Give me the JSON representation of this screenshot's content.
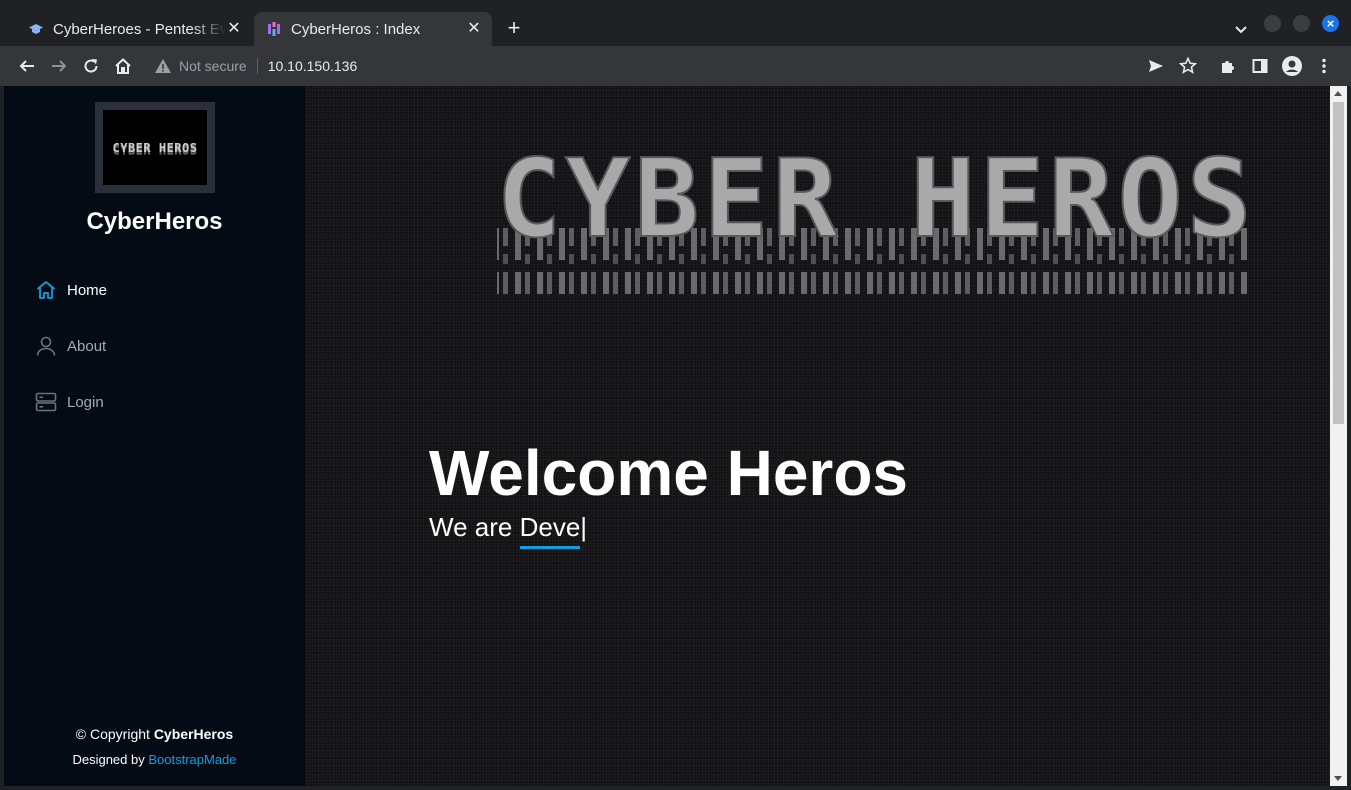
{
  "browser": {
    "tabs": [
      {
        "title": "CyberHeroes - Pentest Ev",
        "active": false
      },
      {
        "title": "CyberHeros : Index",
        "active": true
      }
    ],
    "security_label": "Not secure",
    "url": "10.10.150.136"
  },
  "sidebar": {
    "logo_text": "CYBER HEROS",
    "site_name": "CyberHeros",
    "nav": [
      {
        "label": "Home",
        "icon": "house-icon",
        "active": true
      },
      {
        "label": "About",
        "icon": "person-icon",
        "active": false
      },
      {
        "label": "Login",
        "icon": "server-icon",
        "active": false
      }
    ],
    "footer": {
      "copyright_prefix": "© Copyright",
      "copyright_name": "CyberHeros",
      "designed_by": "Designed by",
      "designer": "BootstrapMade"
    }
  },
  "hero": {
    "banner_text": "CYBER HEROS",
    "title": "Welcome Heros",
    "subtitle_prefix": "We are",
    "typed_text": "Deve",
    "cursor": "|"
  },
  "colors": {
    "accent": "#149ddd",
    "sidebar_bg": "#040b14",
    "hero_bg": "#121214"
  }
}
